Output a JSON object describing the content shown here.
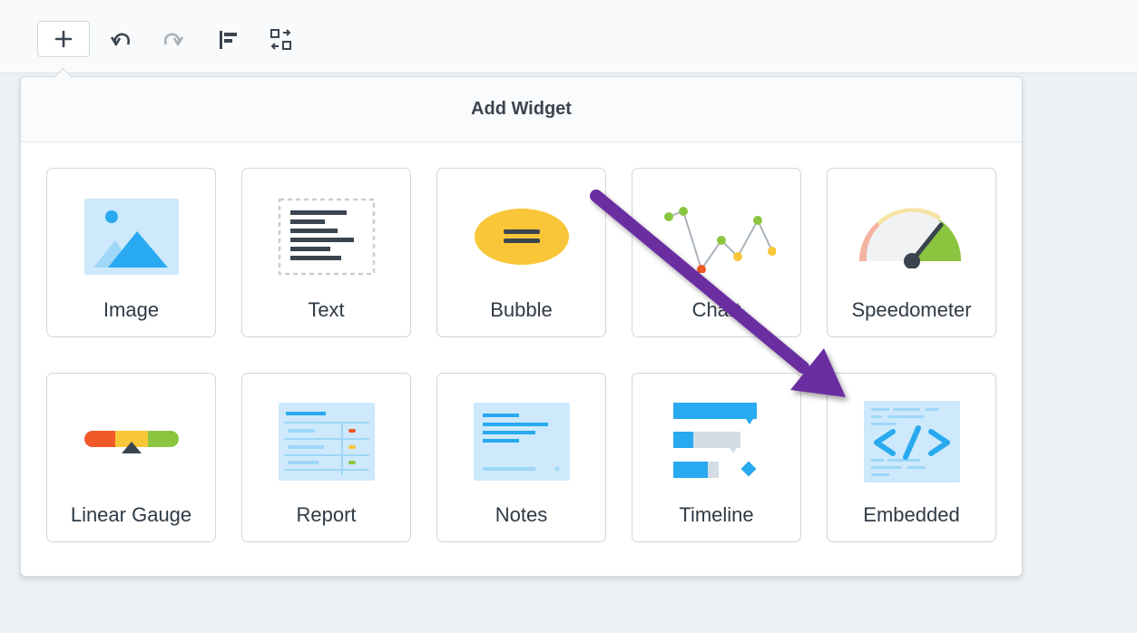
{
  "panel": {
    "title": "Add Widget"
  },
  "widgets": [
    {
      "label": "Image"
    },
    {
      "label": "Text"
    },
    {
      "label": "Bubble"
    },
    {
      "label": "Chart"
    },
    {
      "label": "Speedometer"
    },
    {
      "label": "Linear Gauge"
    },
    {
      "label": "Report"
    },
    {
      "label": "Notes"
    },
    {
      "label": "Timeline"
    },
    {
      "label": "Embedded"
    }
  ],
  "colors": {
    "accent": "#29a9f0",
    "arrow": "#6a2fa0",
    "yellow": "#f8c638",
    "green": "#8bc53f",
    "red": "#f05a28"
  }
}
